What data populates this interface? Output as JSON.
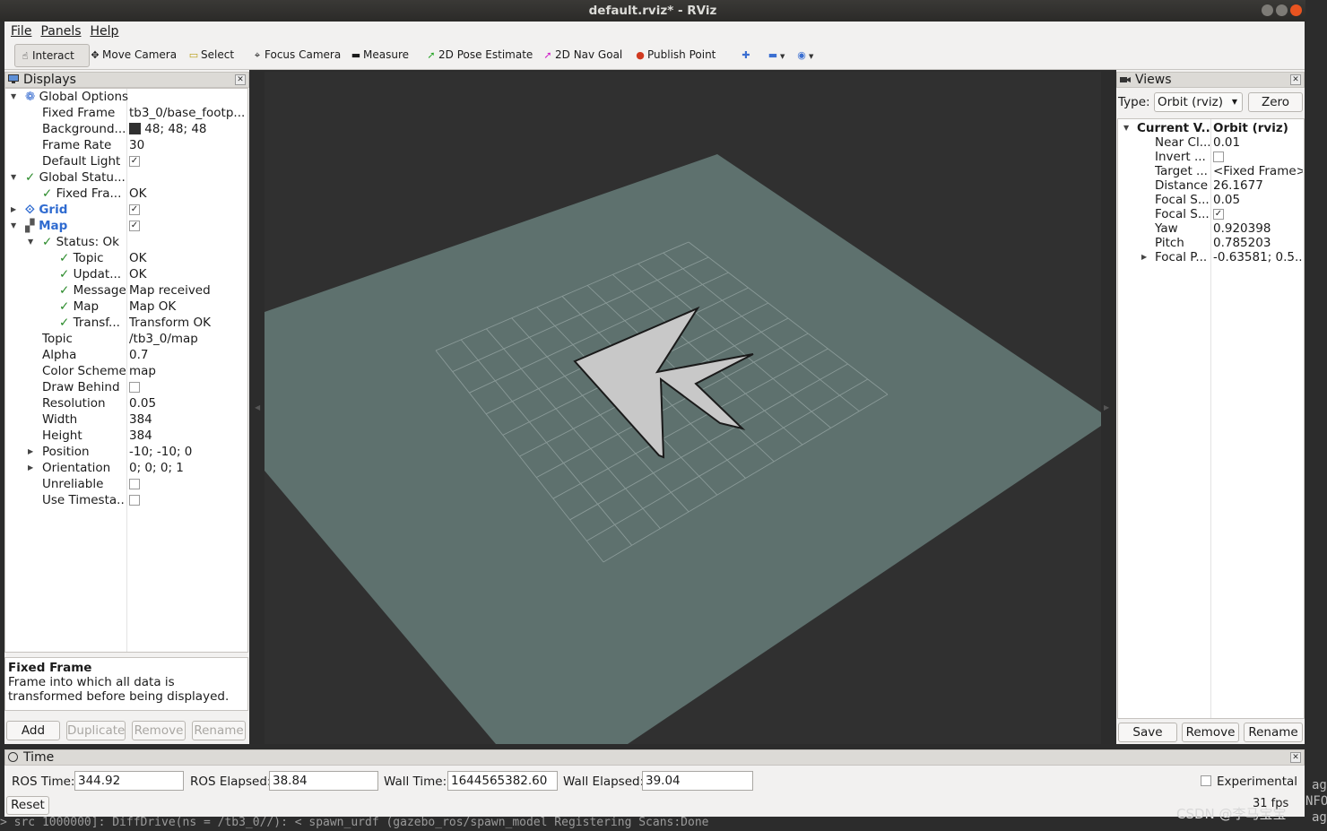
{
  "window": {
    "title": "default.rviz* - RViz"
  },
  "menu": [
    "File",
    "Panels",
    "Help"
  ],
  "toolbar": {
    "interact": "Interact",
    "move_camera": "Move Camera",
    "select": "Select",
    "focus_camera": "Focus Camera",
    "measure": "Measure",
    "pose_estimate": "2D Pose Estimate",
    "nav_goal": "2D Nav Goal",
    "publish_point": "Publish Point"
  },
  "displays": {
    "title": "Displays",
    "rows": [
      {
        "key": "Global Options",
        "value": ""
      },
      {
        "key": "Fixed Frame",
        "value": "tb3_0/base_footp..."
      },
      {
        "key": "Background...",
        "value": "48; 48; 48"
      },
      {
        "key": "Frame Rate",
        "value": "30"
      },
      {
        "key": "Default Light",
        "value": ""
      },
      {
        "key": "Global Statu...",
        "value": ""
      },
      {
        "key": "Fixed Fra...",
        "value": "OK"
      },
      {
        "key": "Grid",
        "value": ""
      },
      {
        "key": "Map",
        "value": ""
      },
      {
        "key": "Status: Ok",
        "value": ""
      },
      {
        "key": "Topic",
        "value": "OK"
      },
      {
        "key": "Updat...",
        "value": "OK"
      },
      {
        "key": "Message",
        "value": "Map received"
      },
      {
        "key": "Map",
        "value": "Map OK"
      },
      {
        "key": "Transf...",
        "value": "Transform OK"
      },
      {
        "key": "Topic",
        "value": "/tb3_0/map"
      },
      {
        "key": "Alpha",
        "value": "0.7"
      },
      {
        "key": "Color Scheme",
        "value": "map"
      },
      {
        "key": "Draw Behind",
        "value": ""
      },
      {
        "key": "Resolution",
        "value": "0.05"
      },
      {
        "key": "Width",
        "value": "384"
      },
      {
        "key": "Height",
        "value": "384"
      },
      {
        "key": "Position",
        "value": "-10; -10; 0"
      },
      {
        "key": "Orientation",
        "value": "0; 0; 0; 1"
      },
      {
        "key": "Unreliable",
        "value": ""
      },
      {
        "key": "Use Timesta...",
        "value": ""
      }
    ],
    "help_title": "Fixed Frame",
    "help_text": "Frame into which all data is transformed before being displayed.",
    "buttons": {
      "add": "Add",
      "duplicate": "Duplicate",
      "remove": "Remove",
      "rename": "Rename"
    }
  },
  "views": {
    "title": "Views",
    "type_label": "Type:",
    "type_value": "Orbit (rviz)",
    "zero": "Zero",
    "rows": [
      {
        "key": "Current V...",
        "value": "Orbit (rviz)"
      },
      {
        "key": "Near Cl...",
        "value": "0.01"
      },
      {
        "key": "Invert ...",
        "value": ""
      },
      {
        "key": "Target ...",
        "value": "<Fixed Frame>"
      },
      {
        "key": "Distance",
        "value": "26.1677"
      },
      {
        "key": "Focal S...",
        "value": "0.05"
      },
      {
        "key": "Focal S...",
        "value": ""
      },
      {
        "key": "Yaw",
        "value": "0.920398"
      },
      {
        "key": "Pitch",
        "value": "0.785203"
      },
      {
        "key": "Focal P...",
        "value": "-0.63581; 0.5..."
      }
    ],
    "buttons": {
      "save": "Save",
      "remove": "Remove",
      "rename": "Rename"
    }
  },
  "time": {
    "title": "Time",
    "ros_time_label": "ROS Time:",
    "ros_time": "344.92",
    "ros_elapsed_label": "ROS Elapsed:",
    "ros_elapsed": "38.84",
    "wall_time_label": "Wall Time:",
    "wall_time": "1644565382.60",
    "wall_elapsed_label": "Wall Elapsed:",
    "wall_elapsed": "39.04",
    "experimental": "Experimental",
    "reset": "Reset",
    "fps": "31 fps"
  },
  "colors": {
    "background": "#303030",
    "map_plane": "#5e716e",
    "grid": "#8a9a98",
    "free_space": "#c8c8c8"
  },
  "terminal": {
    "line": "  > src                                    1000000]: DiffDrive(ns = /tb3_0//): <      spawn_urdf (gazebo_ros/spawn_model     Registering Scans:Done",
    "watermark": "CSDN @李马宝宝",
    "right_snippets": [
      "ag",
      "NFO",
      "ag"
    ]
  }
}
